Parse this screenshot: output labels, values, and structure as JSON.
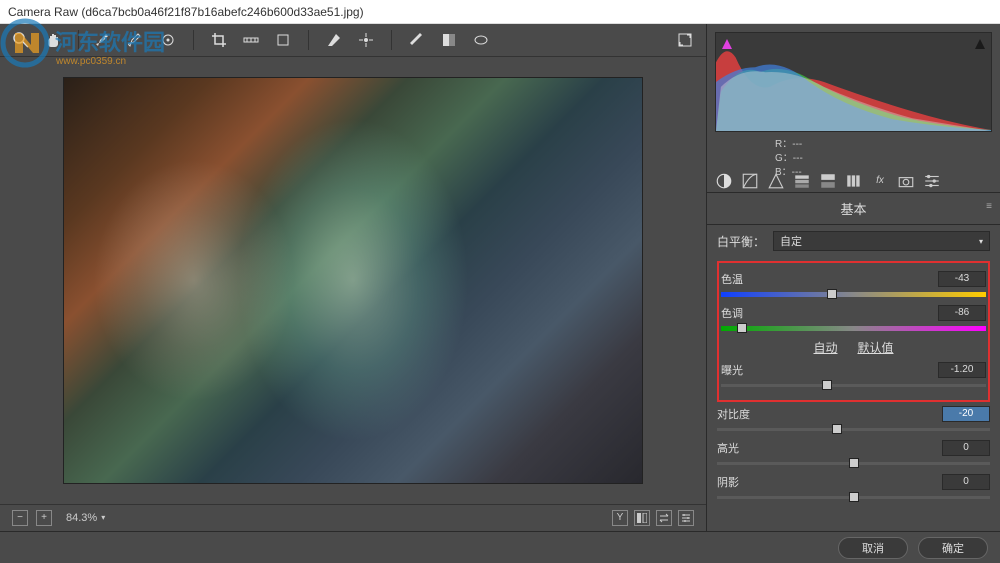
{
  "window": {
    "title": "Camera Raw (d6ca7bcb0a46f21f87b16abefc246b600d33ae51.jpg)"
  },
  "toolbar": {
    "icons": [
      "zoom",
      "hand",
      "eyedropper-wb",
      "eyedropper-color",
      "target",
      "crop",
      "straighten",
      "transform",
      "brush",
      "gradient",
      "radial",
      "redeye",
      "rotate-left",
      "rotate-right"
    ],
    "fullscreen_icon": "fullscreen"
  },
  "preview": {
    "zoom": "84.3%"
  },
  "rgb": {
    "r_label": "R：",
    "g_label": "G：",
    "b_label": "B：",
    "r": "---",
    "g": "---",
    "b": "---"
  },
  "tabs": [
    "basic",
    "curve",
    "detail",
    "hsl",
    "split",
    "lens",
    "fx",
    "camera",
    "presets"
  ],
  "panel": {
    "title": "基本",
    "wb_label": "白平衡：",
    "wb_value": "自定",
    "temp_label": "色温",
    "temp_value": "-43",
    "tint_label": "色调",
    "tint_value": "-86",
    "auto_label": "自动",
    "default_label": "默认值",
    "exposure_label": "曝光",
    "exposure_value": "-1.20",
    "contrast_label": "对比度",
    "contrast_value": "-20",
    "highlights_label": "高光",
    "highlights_value": "0",
    "shadows_label": "阴影",
    "shadows_value": "0"
  },
  "footer": {
    "cancel": "取消",
    "ok": "确定"
  },
  "chart_data": {
    "type": "area",
    "title": "Histogram",
    "xlabel": "",
    "ylabel": "",
    "xlim": [
      0,
      255
    ],
    "note": "RGB composite histogram; shadow-clip (magenta) and highlight-clip (black) warning triangles shown"
  }
}
